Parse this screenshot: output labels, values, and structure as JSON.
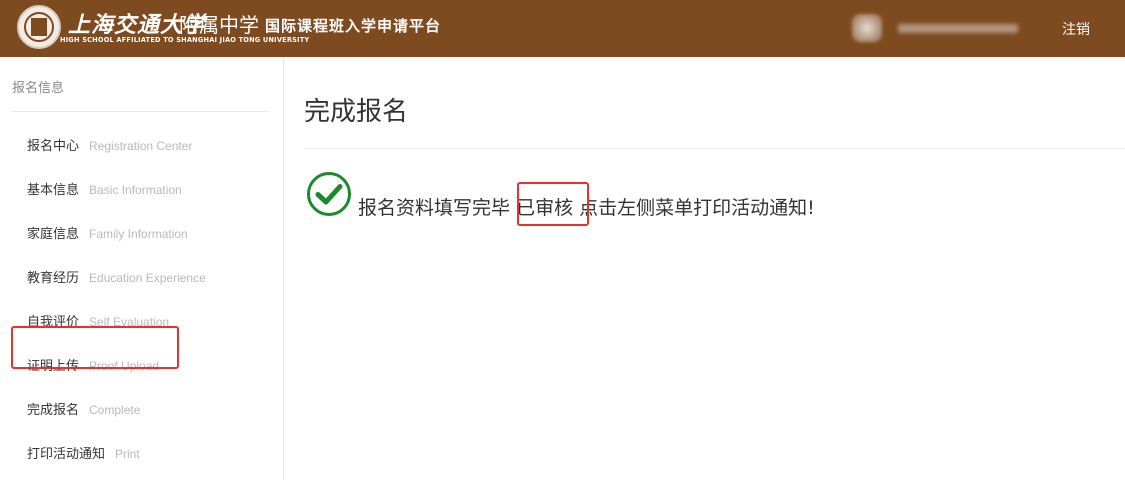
{
  "header": {
    "school_name_cn": "上海交通大学",
    "affiliated_cn": "附属中学",
    "school_name_en": "HIGH SCHOOL AFFILIATED TO SHANGHAI JIAO TONG UNIVERSITY",
    "platform_title": "国际课程班入学申请平台",
    "logout_label": "注销",
    "colors": {
      "brand": "#7e4a1f"
    }
  },
  "sidebar": {
    "heading": "报名信息",
    "items": [
      {
        "cn": "报名中心",
        "en": "Registration Center"
      },
      {
        "cn": "基本信息",
        "en": "Basic Information"
      },
      {
        "cn": "家庭信息",
        "en": "Family Information"
      },
      {
        "cn": "教育经历",
        "en": "Education Experience"
      },
      {
        "cn": "自我评价",
        "en": "Self Evaluation"
      },
      {
        "cn": "证明上传",
        "en": "Proof Upload"
      },
      {
        "cn": "完成报名",
        "en": "Complete"
      },
      {
        "cn": "打印活动通知",
        "en": "Print"
      }
    ],
    "active_item": "完成报名"
  },
  "main": {
    "title": "完成报名",
    "message_prefix": "报名资料填写完毕",
    "status": "已审核",
    "message_suffix": "点击左侧菜单打印活动通知!",
    "icon": "check-circle-icon",
    "colors": {
      "success": "#1b8a2a",
      "highlight": "#e5322d"
    }
  }
}
